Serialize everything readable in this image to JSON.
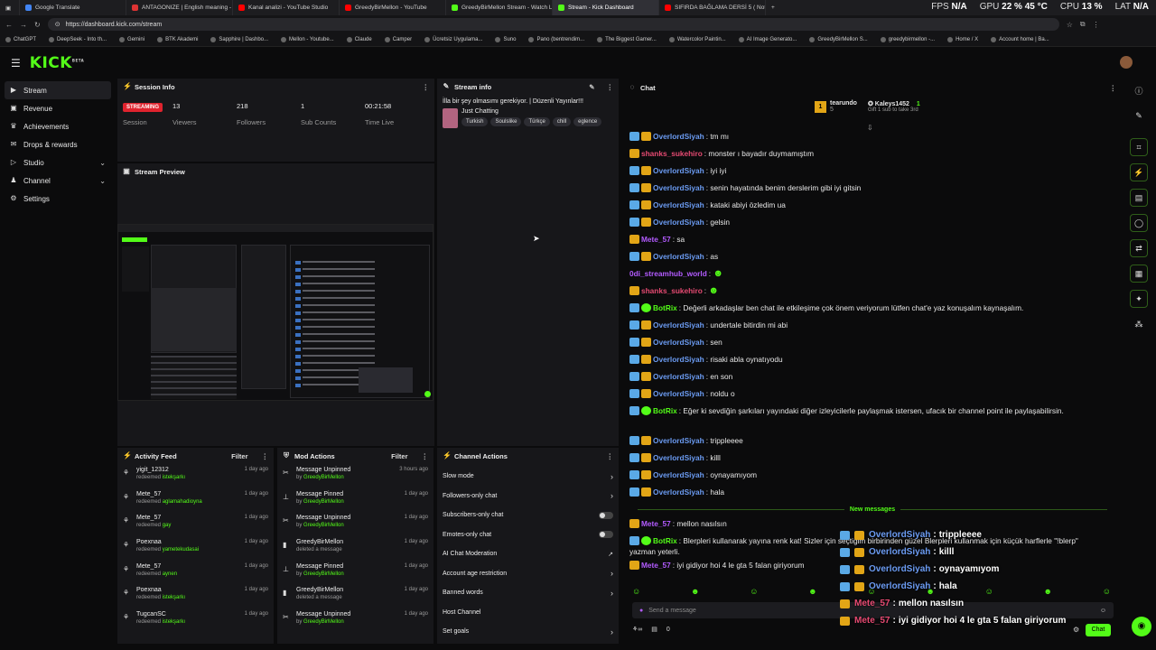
{
  "browser": {
    "tabs": [
      {
        "title": "Google Translate",
        "color": "#4285f4"
      },
      {
        "title": "ANTAGONIZE | English meaning -",
        "color": "#d33"
      },
      {
        "title": "Kanal analizi - YouTube Studio",
        "color": "#f00"
      },
      {
        "title": "GreedyBirMellon - YouTube",
        "color": "#f00"
      },
      {
        "title": "GreedyBirMellon Stream - Watch L",
        "color": "#53fc18"
      },
      {
        "title": "Stream - Kick Dashboard",
        "color": "#53fc18"
      },
      {
        "title": "SIFIRDA BAĞLAMA DERSİ 5 ( Nota",
        "color": "#f00"
      }
    ],
    "url": "https://dashboard.kick.com/stream",
    "stats": {
      "fps_label": "FPS",
      "fps": "N/A",
      "gpu_label": "GPU",
      "gpu": "22 % 45 °C",
      "cpu_label": "CPU",
      "cpu": "13 %",
      "lat_label": "LAT",
      "lat": "N/A"
    },
    "bookmarks": [
      "ChatGPT",
      "DeepSeek - Into th...",
      "Gemini",
      "BTK Akademi",
      "Sapphire | Dashbo...",
      "Mellon - Youtube...",
      "Claude",
      "Camper",
      "Ücretsiz Uygulama...",
      "Suno",
      "Pano (bentrendim...",
      "The Biggest Gamer...",
      "Watercolor Paintin...",
      "AI Image Generato...",
      "GreedyBirMellon S...",
      "greedybirmellon -...",
      "Home / X",
      "Account home | Ba..."
    ]
  },
  "brand": {
    "logo": "KICK",
    "beta": "BETA",
    "accent": "#53fc18"
  },
  "sidebar": {
    "items": [
      {
        "label": "Stream",
        "icon": "play-icon"
      },
      {
        "label": "Revenue",
        "icon": "wallet-icon"
      },
      {
        "label": "Achievements",
        "icon": "trophy-icon"
      },
      {
        "label": "Drops & rewards",
        "icon": "gift-icon"
      },
      {
        "label": "Studio",
        "icon": "studio-icon"
      },
      {
        "label": "Channel",
        "icon": "user-icon"
      },
      {
        "label": "Settings",
        "icon": "gear-icon"
      }
    ]
  },
  "session": {
    "title": "Session Info",
    "status": "STREAMING",
    "status_label": "Session",
    "stats": [
      {
        "value": "13",
        "label": "Viewers"
      },
      {
        "value": "218",
        "label": "Followers"
      },
      {
        "value": "1",
        "label": "Sub Counts"
      },
      {
        "value": "00:21:58",
        "label": "Time Live"
      }
    ]
  },
  "stream_info": {
    "title": "Stream info",
    "stream_title": "İlla bir şey olmasımı gerekiyor. | Düzenli Yayınlar!!!",
    "category": "Just Chatting",
    "tags": [
      "Turkish",
      "Soulslike",
      "Türkçe",
      "chill",
      "eglence"
    ]
  },
  "preview": {
    "title": "Stream Preview"
  },
  "activity": {
    "title": "Activity Feed",
    "filter": "Filter",
    "items": [
      {
        "user": "yigit_12312",
        "action": "redeemed",
        "reward": "istekşarkı",
        "time": "1 day ago"
      },
      {
        "user": "Mete_57",
        "action": "redeemed",
        "reward": "aglamahadioyna",
        "time": "1 day ago"
      },
      {
        "user": "Mete_57",
        "action": "redeemed",
        "reward": "gay",
        "time": "1 day ago"
      },
      {
        "user": "Poexnaa",
        "action": "redeemed",
        "reward": "yametekudasai",
        "time": "1 day ago"
      },
      {
        "user": "Mete_57",
        "action": "redeemed",
        "reward": "aynen",
        "time": "1 day ago"
      },
      {
        "user": "Poexnaa",
        "action": "redeemed",
        "reward": "istekşarkı",
        "time": "1 day ago"
      },
      {
        "user": "TugcanSC",
        "action": "redeemed",
        "reward": "istekşarkı",
        "time": "1 day ago"
      }
    ]
  },
  "mod_actions": {
    "title": "Mod Actions",
    "filter": "Filter",
    "items": [
      {
        "action": "Message Unpinned",
        "sub": "by",
        "by": "GreedyBirMellon",
        "time": "3 hours ago",
        "icon": "unpin-icon"
      },
      {
        "action": "Message Pinned",
        "sub": "by",
        "by": "GreedyBirMellon",
        "time": "1 day ago",
        "icon": "pin-icon"
      },
      {
        "action": "Message Unpinned",
        "sub": "by",
        "by": "GreedyBirMellon",
        "time": "1 day ago",
        "icon": "unpin-icon"
      },
      {
        "action": "GreedyBirMellon",
        "sub": "deleted a message",
        "by": "",
        "time": "1 day ago",
        "icon": "trash-icon"
      },
      {
        "action": "Message Pinned",
        "sub": "by",
        "by": "GreedyBirMellon",
        "time": "1 day ago",
        "icon": "pin-icon"
      },
      {
        "action": "GreedyBirMellon",
        "sub": "deleted a message",
        "by": "",
        "time": "1 day ago",
        "icon": "trash-icon"
      },
      {
        "action": "Message Unpinned",
        "sub": "by",
        "by": "GreedyBirMellon",
        "time": "1 day ago",
        "icon": "unpin-icon"
      }
    ]
  },
  "channel_actions": {
    "title": "Channel Actions",
    "items": [
      {
        "label": "Slow mode",
        "control": "chevron"
      },
      {
        "label": "Followers-only chat",
        "control": "chevron"
      },
      {
        "label": "Subscribers-only chat",
        "control": "toggle"
      },
      {
        "label": "Emotes-only chat",
        "control": "toggle"
      },
      {
        "label": "AI Chat Moderation",
        "control": "external"
      },
      {
        "label": "Account age restriction",
        "control": "chevron"
      },
      {
        "label": "Banned words",
        "control": "chevron"
      },
      {
        "label": "Host Channel",
        "control": "none"
      },
      {
        "label": "Set goals",
        "control": "chevron"
      }
    ]
  },
  "chat": {
    "title": "Chat",
    "top_gifters": [
      {
        "rank": "1",
        "name": "tearundo",
        "count": "5"
      },
      {
        "name": "Kaleys1452",
        "count": "1",
        "note": "Gift 1 sub to take 3rd"
      }
    ],
    "messages": [
      {
        "user": "OverlordSiyah",
        "color": "blue",
        "badges": [
          "blue",
          "crown"
        ],
        "text": "tm mı"
      },
      {
        "user": "shanks_sukehiro",
        "color": "pink",
        "badges": [
          "crown"
        ],
        "text": "monster ı bayadır duymamıştım"
      },
      {
        "user": "OverlordSiyah",
        "color": "blue",
        "badges": [
          "blue",
          "crown"
        ],
        "text": "iyi iyi"
      },
      {
        "user": "OverlordSiyah",
        "color": "blue",
        "badges": [
          "blue",
          "crown"
        ],
        "text": "senin hayatında benim derslerim gibi iyi gitsin"
      },
      {
        "user": "OverlordSiyah",
        "color": "blue",
        "badges": [
          "blue",
          "crown"
        ],
        "text": "kataki abiyi özledim ua"
      },
      {
        "user": "OverlordSiyah",
        "color": "blue",
        "badges": [
          "blue",
          "crown"
        ],
        "text": "gelsin"
      },
      {
        "user": "Mete_57",
        "color": "purple",
        "badges": [
          "crown"
        ],
        "text": "sa"
      },
      {
        "user": "OverlordSiyah",
        "color": "blue",
        "badges": [
          "blue",
          "crown"
        ],
        "text": "as"
      },
      {
        "user": "0di_streamhub_world",
        "color": "purple",
        "badges": [],
        "text": "",
        "emote": true
      },
      {
        "user": "shanks_sukehiro",
        "color": "pink",
        "badges": [
          "crown"
        ],
        "text": "",
        "emote": true
      },
      {
        "user": "BotRix",
        "color": "green",
        "badges": [
          "blue",
          "green"
        ],
        "text": "Değerli arkadaşlar ben chat ile etkileşime çok önem veriyorum lütfen chat'e yaz konuşalım kaynaşalım."
      },
      {
        "user": "OverlordSiyah",
        "color": "blue",
        "badges": [
          "blue",
          "crown"
        ],
        "text": "undertale bitirdin mi abi"
      },
      {
        "user": "OverlordSiyah",
        "color": "blue",
        "badges": [
          "blue",
          "crown"
        ],
        "text": "sen"
      },
      {
        "user": "OverlordSiyah",
        "color": "blue",
        "badges": [
          "blue",
          "crown"
        ],
        "text": "risaki abla oynatıyodu"
      },
      {
        "user": "OverlordSiyah",
        "color": "blue",
        "badges": [
          "blue",
          "crown"
        ],
        "text": "en son"
      },
      {
        "user": "OverlordSiyah",
        "color": "blue",
        "badges": [
          "blue",
          "crown"
        ],
        "text": "noldu o"
      },
      {
        "user": "BotRix",
        "color": "green",
        "badges": [
          "blue",
          "green"
        ],
        "text": "Eğer ki sevdiğin şarkıları yayındaki diğer izleyicilerle paylaşmak istersen, ufacık bir channel point ile paylaşabilirsin."
      },
      {
        "user": "OverlordSiyah",
        "color": "blue",
        "badges": [
          "blue",
          "crown"
        ],
        "text": "trippleeee"
      },
      {
        "user": "OverlordSiyah",
        "color": "blue",
        "badges": [
          "blue",
          "crown"
        ],
        "text": "killl"
      },
      {
        "user": "OverlordSiyah",
        "color": "blue",
        "badges": [
          "blue",
          "crown"
        ],
        "text": "oynayamıyom"
      },
      {
        "user": "OverlordSiyah",
        "color": "blue",
        "badges": [
          "blue",
          "crown"
        ],
        "text": "hala"
      }
    ],
    "new_messages_label": "New messages",
    "new_messages": [
      {
        "user": "Mete_57",
        "color": "purple",
        "badges": [
          "crown"
        ],
        "text": "mellon nasılsın"
      },
      {
        "user": "BotRix",
        "color": "green",
        "badges": [
          "blue",
          "green"
        ],
        "text": "Blerpleri kullanarak yayına renk kat! Sizler için seçtiğim birbirinden güzel Blerpleri kullanmak için küçük harflerle \"!blerp\" yazman yeterli."
      },
      {
        "user": "Mete_57",
        "color": "purple",
        "badges": [
          "crown"
        ],
        "text": "iyi gidiyor hoi 4 le gta 5 falan giriyorum"
      }
    ],
    "input_placeholder": "Send a message",
    "points": "0",
    "send_button": "Chat"
  },
  "overlay": [
    {
      "user": "OverlordSiyah",
      "color": "blue",
      "badges": [
        "blue",
        "crown"
      ],
      "text": "trippleeee"
    },
    {
      "user": "OverlordSiyah",
      "color": "blue",
      "badges": [
        "blue",
        "crown"
      ],
      "text": "killl"
    },
    {
      "user": "OverlordSiyah",
      "color": "blue",
      "badges": [
        "blue",
        "crown"
      ],
      "text": "oynayamıyom"
    },
    {
      "user": "OverlordSiyah",
      "color": "blue",
      "badges": [
        "blue",
        "crown"
      ],
      "text": "hala"
    },
    {
      "user": "Mete_57",
      "color": "pink",
      "badges": [
        "crown"
      ],
      "text": "mellon nasılsın"
    },
    {
      "user": "Mete_57",
      "color": "pink",
      "badges": [
        "crown"
      ],
      "text": "iyi gidiyor hoi 4 le gta 5 falan giriyorum"
    }
  ]
}
